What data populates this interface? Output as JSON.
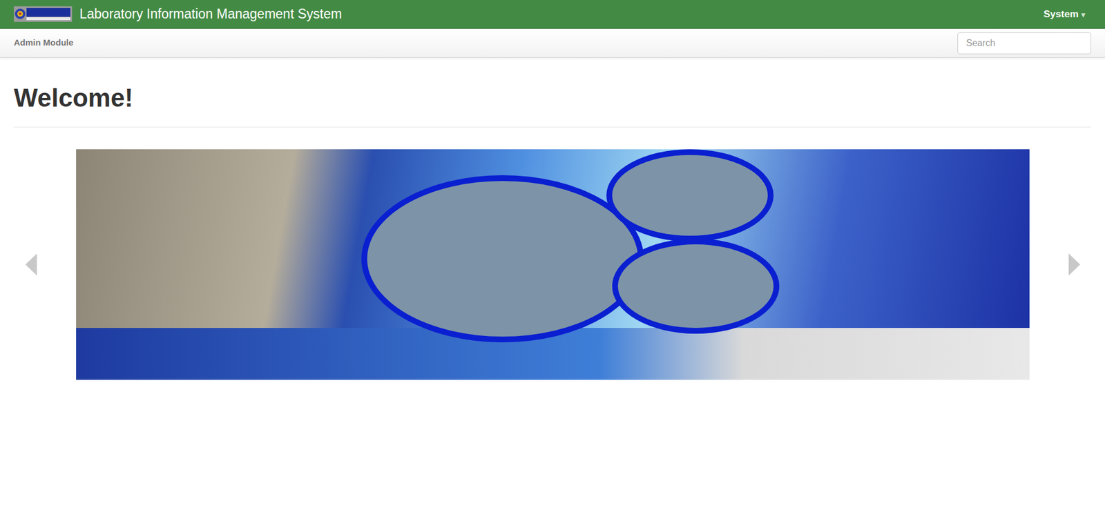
{
  "header": {
    "title": "Laboratory Information Management System",
    "menu": {
      "label": "System",
      "caret": "▾"
    }
  },
  "subnav": {
    "module": "Admin Module",
    "search": {
      "placeholder": "Search"
    }
  },
  "page": {
    "heading": "Welcome!"
  }
}
